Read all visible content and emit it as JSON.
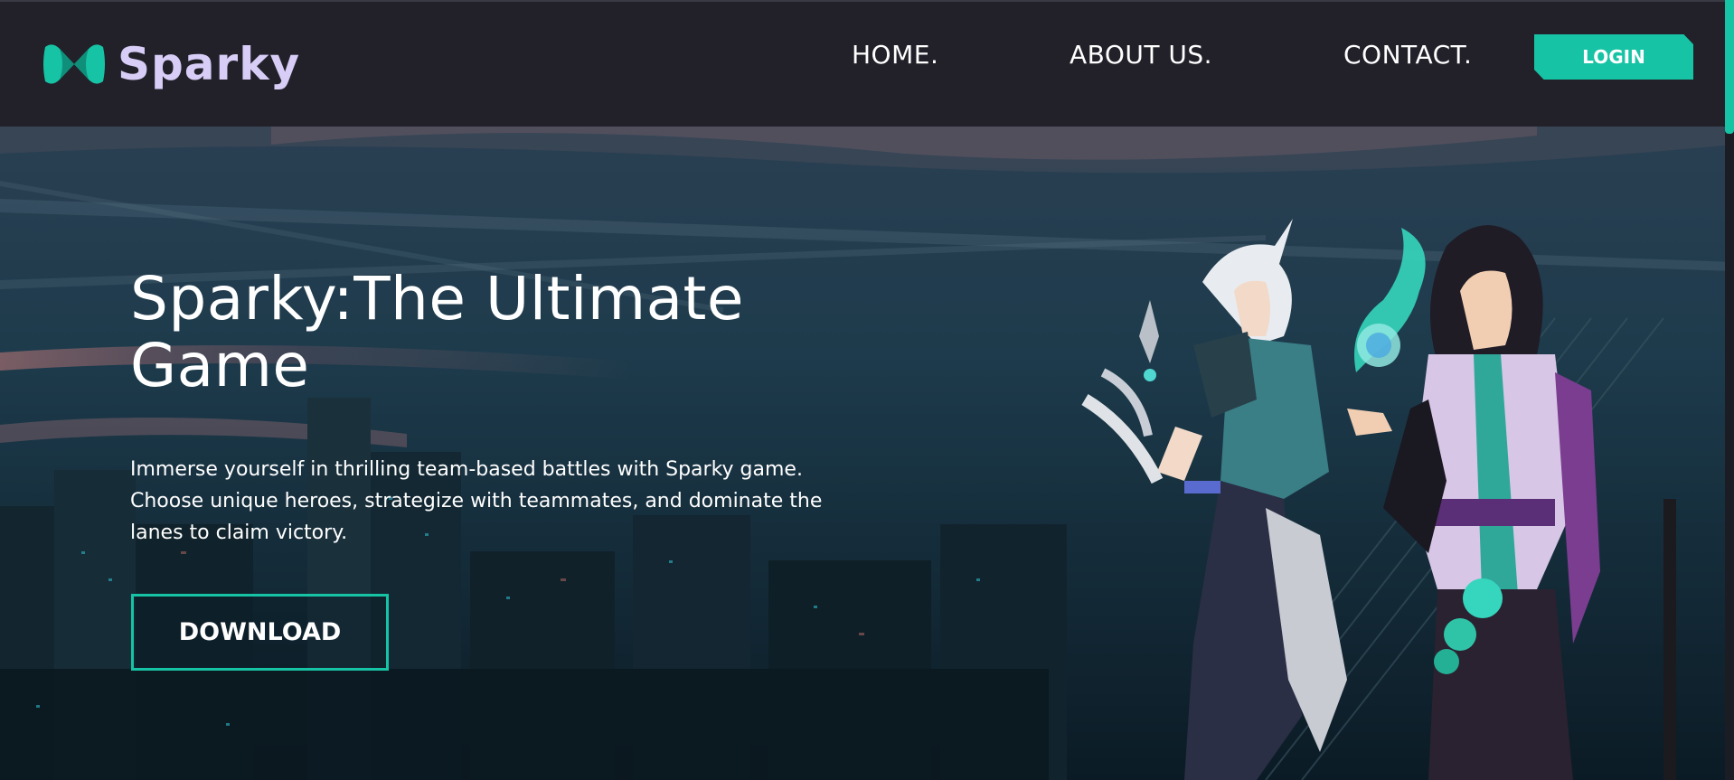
{
  "header": {
    "brand": "Sparky",
    "nav": {
      "home": "HOME.",
      "about": "ABOUT US.",
      "contact": "CONTACT."
    },
    "login_label": "LOGIN"
  },
  "hero": {
    "title": "Sparky:The Ultimate Game",
    "description": "Immerse yourself in thrilling team-based battles with Sparky game. Choose unique heroes, strategize with teammates, and dominate the lanes to claim victory.",
    "download_label": "DOWNLOAD"
  },
  "colors": {
    "accent": "#17c3a5",
    "header_bg": "#22212a",
    "brand_text": "#d7cdf6"
  },
  "icons": {
    "logo": "sparky-logo-icon"
  }
}
